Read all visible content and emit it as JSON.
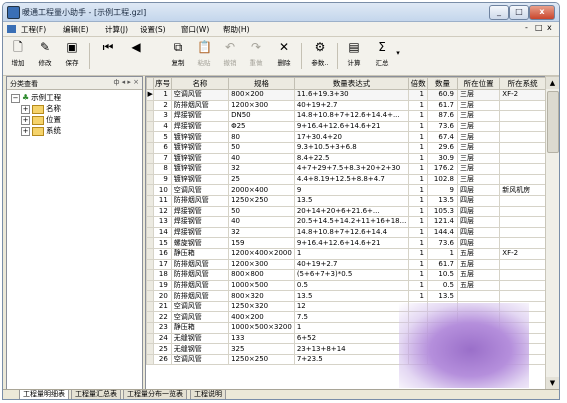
{
  "window": {
    "title": "暖通工程量小助手 - [示例工程.gzl]",
    "caption_buttons": [
      "_",
      "□",
      "x"
    ]
  },
  "menu": {
    "items": [
      "工程(F)",
      "编辑(E)",
      "计算(J)",
      "设置(S)",
      "窗口(W)",
      "帮助(H)"
    ],
    "mdi_controls": [
      "-",
      "□",
      "x"
    ]
  },
  "toolbar": [
    {
      "label": "增加",
      "icon": "add-icon",
      "enabled": true
    },
    {
      "label": "修改",
      "icon": "edit-icon",
      "enabled": true
    },
    {
      "label": "保存",
      "icon": "save-icon",
      "enabled": true
    },
    {
      "label": "",
      "icon": "first-icon",
      "enabled": true
    },
    {
      "label": "",
      "icon": "prev-icon",
      "enabled": true
    },
    {
      "label": "复制",
      "icon": "copy-icon",
      "enabled": true
    },
    {
      "label": "粘贴",
      "icon": "paste-icon",
      "enabled": false
    },
    {
      "label": "撤销",
      "icon": "undo-icon",
      "enabled": false
    },
    {
      "label": "重做",
      "icon": "redo-icon",
      "enabled": false
    },
    {
      "label": "删除",
      "icon": "delete-icon",
      "enabled": true
    },
    {
      "label": "参数..",
      "icon": "params-icon",
      "enabled": true
    },
    {
      "label": "计算",
      "icon": "calc-icon",
      "enabled": true
    },
    {
      "label": "汇总",
      "icon": "sum-icon",
      "enabled": true
    }
  ],
  "tree": {
    "header": "分类查看",
    "header_buttons": "ф ◂ ▸ ×",
    "root": "示例工程",
    "children": [
      "名称",
      "位置",
      "系统"
    ]
  },
  "table": {
    "columns": [
      "序号",
      "名称",
      "规格",
      "数量表达式",
      "倍数",
      "数量",
      "所在位置",
      "所在系统"
    ],
    "rows": [
      [
        "1",
        "空调风管",
        "800×200",
        "11.6+19.3+30",
        "1",
        "60.9",
        "三层",
        "XF-2"
      ],
      [
        "2",
        "防排烟风管",
        "1200×300",
        "40+19+2.7",
        "1",
        "61.7",
        "三层",
        ""
      ],
      [
        "3",
        "焊接钢管",
        "DN50",
        "14.8+10.8+7+12.6+14.4+...",
        "1",
        "87.6",
        "三层",
        ""
      ],
      [
        "4",
        "焊接钢管",
        "Φ25",
        "9+16.4+12.6+14.6+21",
        "1",
        "73.6",
        "三层",
        ""
      ],
      [
        "5",
        "镀锌钢管",
        "80",
        "17+30.4+20",
        "1",
        "67.4",
        "三层",
        ""
      ],
      [
        "6",
        "镀锌钢管",
        "50",
        "9.3+10.5+3+6.8",
        "1",
        "29.6",
        "三层",
        ""
      ],
      [
        "7",
        "镀锌钢管",
        "40",
        "8.4+22.5",
        "1",
        "30.9",
        "三层",
        ""
      ],
      [
        "8",
        "镀锌钢管",
        "32",
        "4+7+29+7.5+8.3+20+2+30",
        "1",
        "176.2",
        "三层",
        ""
      ],
      [
        "9",
        "镀锌钢管",
        "25",
        "4.4+8.19+12.5+8.8+4.7",
        "1",
        "102.8",
        "三层",
        ""
      ],
      [
        "10",
        "空调风管",
        "2000×400",
        "9",
        "1",
        "9",
        "四层",
        "新风机房"
      ],
      [
        "11",
        "防排烟风管",
        "1250×250",
        "13.5",
        "1",
        "13.5",
        "四层",
        ""
      ],
      [
        "12",
        "焊接钢管",
        "50",
        "20+14+20+6+21.6+...",
        "1",
        "105.3",
        "四层",
        ""
      ],
      [
        "13",
        "焊接钢管",
        "40",
        "20.5+14.5+14.2+11+16+18...",
        "1",
        "121.4",
        "四层",
        ""
      ],
      [
        "14",
        "焊接钢管",
        "32",
        "14.8+10.8+7+12.6+14.4",
        "1",
        "144.4",
        "四层",
        ""
      ],
      [
        "15",
        "螺旋钢管",
        "159",
        "9+16.4+12.6+14.6+21",
        "1",
        "73.6",
        "四层",
        ""
      ],
      [
        "16",
        "静压箱",
        "1200×400×2000",
        "1",
        "1",
        "1",
        "五层",
        "XF-2"
      ],
      [
        "17",
        "防排烟风管",
        "1200×300",
        "40+19+2.7",
        "1",
        "61.7",
        "五层",
        ""
      ],
      [
        "18",
        "防排烟风管",
        "800×800",
        "(5+6+7+3)*0.5",
        "1",
        "10.5",
        "五层",
        ""
      ],
      [
        "19",
        "防排烟风管",
        "1000×500",
        "0.5",
        "1",
        "0.5",
        "五层",
        ""
      ],
      [
        "20",
        "防排烟风管",
        "800×320",
        "13.5",
        "1",
        "13.5",
        "",
        ""
      ],
      [
        "21",
        "空调风管",
        "1250×320",
        "12",
        "",
        "",
        "",
        ""
      ],
      [
        "22",
        "空调风管",
        "400×200",
        "7.5",
        "",
        "",
        "",
        ""
      ],
      [
        "23",
        "静压箱",
        "1000×500×3200",
        "1",
        "",
        "",
        "",
        ""
      ],
      [
        "24",
        "无缝钢管",
        "133",
        "6+52",
        "",
        "",
        "",
        ""
      ],
      [
        "25",
        "无缝钢管",
        "325",
        "23+13+8+14",
        "",
        "",
        "",
        ""
      ],
      [
        "26",
        "空调风管",
        "1250×250",
        "7+23.5",
        "",
        "",
        "",
        ""
      ]
    ]
  },
  "tabs": [
    "工程量明细表",
    "工程量汇总表",
    "工程量分布一览表",
    "工程说明"
  ]
}
